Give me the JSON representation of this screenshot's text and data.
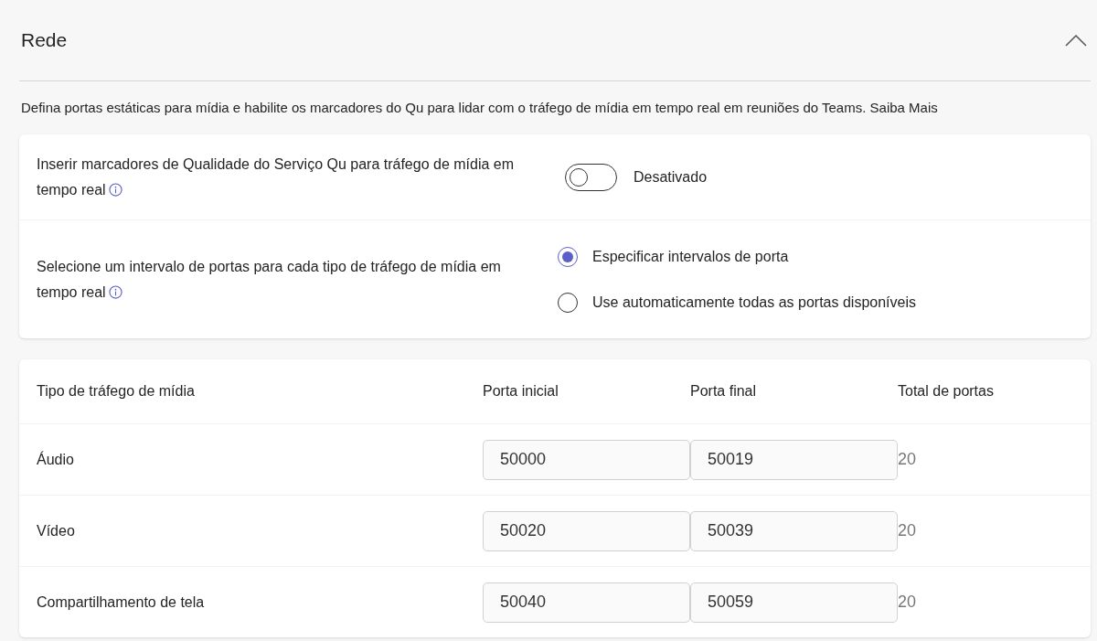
{
  "section": {
    "title": "Rede",
    "expanded": true
  },
  "description": {
    "text": "Defina portas estáticas para mídia e habilite os marcadores do Qu para lidar com o tráfego de mídia em tempo real em reuniões do Teams.",
    "link": "Saiba Mais"
  },
  "settings": [
    {
      "kind": "toggle",
      "label": "Inserir marcadores de Qualidade do Serviço Qu para tráfego de mídia em tempo real",
      "on": false,
      "state_label": "Desativado"
    },
    {
      "kind": "radio",
      "label": "Selecione um intervalo de portas para cada tipo de tráfego de mídia em tempo real",
      "options": [
        {
          "label": "Especificar intervalos de porta",
          "selected": true
        },
        {
          "label": "Use automaticamente todas as portas disponíveis",
          "selected": false
        }
      ]
    }
  ],
  "table": {
    "columns": [
      "Tipo de tráfego de mídia",
      "Porta inicial",
      "Porta final",
      "Total de portas"
    ],
    "rows": [
      {
        "type": "Áudio",
        "start": "50000",
        "end": "50019",
        "total": "20"
      },
      {
        "type": "Vídeo",
        "start": "50020",
        "end": "50039",
        "total": "20"
      },
      {
        "type": "Compartilhamento de tela",
        "start": "50040",
        "end": "50059",
        "total": "20"
      }
    ]
  }
}
